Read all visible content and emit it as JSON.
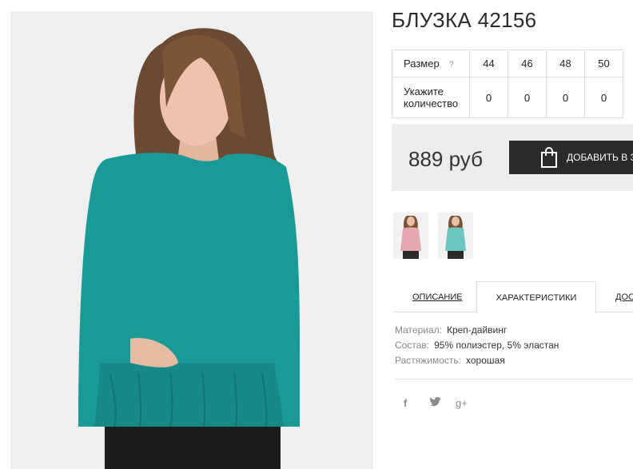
{
  "product": {
    "title": "БЛУЗКА 42156",
    "price": "889 руб",
    "add_to_cart": "ДОБАВИТЬ В ЗАКАЗ"
  },
  "sizes_table": {
    "size_label": "Размер",
    "help_icon": "?",
    "sizes": [
      "44",
      "46",
      "48",
      "50"
    ],
    "qty_label_line1": "Укажите",
    "qty_label_line2": "количество",
    "quantities": [
      "0",
      "0",
      "0",
      "0"
    ]
  },
  "tabs": [
    "ОПИСАНИЕ",
    "ХАРАКТЕРИСТИКИ",
    "ДОСТАВКА"
  ],
  "specs": [
    {
      "key": "Материал:",
      "value": "Креп-дайвинг"
    },
    {
      "key": "Состав:",
      "value": "95% полиэстер, 5% эластан"
    },
    {
      "key": "Растяжимость:",
      "value": "хорошая"
    }
  ],
  "social": [
    "f",
    "t",
    "g+"
  ],
  "icons": {
    "cart": "shopping-bag-icon",
    "facebook": "facebook-icon",
    "twitter": "twitter-icon",
    "gplus": "google-plus-icon"
  },
  "colors": {
    "blouse": "#1a9a96",
    "button": "#2b2b2b",
    "price_bg": "#ececec"
  }
}
